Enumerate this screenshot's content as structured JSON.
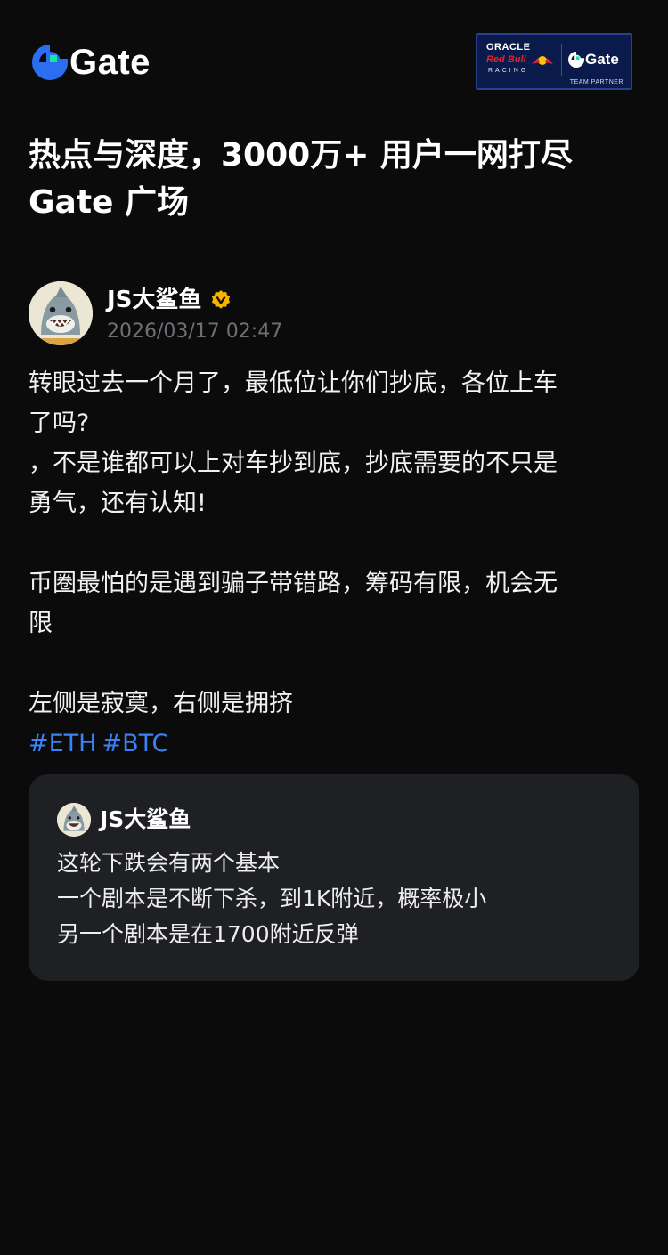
{
  "header": {
    "brand": "Gate",
    "partner": {
      "oracle": "ORACLE",
      "redbull": "Red Bull",
      "racing": "RACING",
      "gate": "Gate",
      "team": "TEAM PARTNER"
    }
  },
  "headline": {
    "line1": "热点与深度，3000万+ 用户一网打尽",
    "line2": "Gate 广场"
  },
  "post": {
    "author": "JS大鲨鱼",
    "timestamp": "2026/03/17 02:47",
    "lines": [
      "转眼过去一个月了，最低位让你们抄底，各位上车",
      "了吗?",
      "，不是谁都可以上对车抄到底，抄底需要的不只是",
      "勇气，还有认知!",
      "",
      "币圈最怕的是遇到骗子带错路，筹码有限，机会无",
      "限",
      "",
      "左侧是寂寞，右侧是拥挤"
    ],
    "hashtags": [
      "#ETH",
      "#BTC"
    ]
  },
  "quote": {
    "author": "JS大鲨鱼",
    "lines": [
      "这轮下跌会有两个基本",
      "一个剧本是不断下杀，到1K附近，概率极小",
      "另一个剧本是在1700附近反弹"
    ]
  },
  "colors": {
    "background": "#0b0b0c",
    "accent_blue": "#3b82f6",
    "gate_green": "#17e6a1",
    "verified": "#f5b400",
    "card": "#1f2023"
  }
}
